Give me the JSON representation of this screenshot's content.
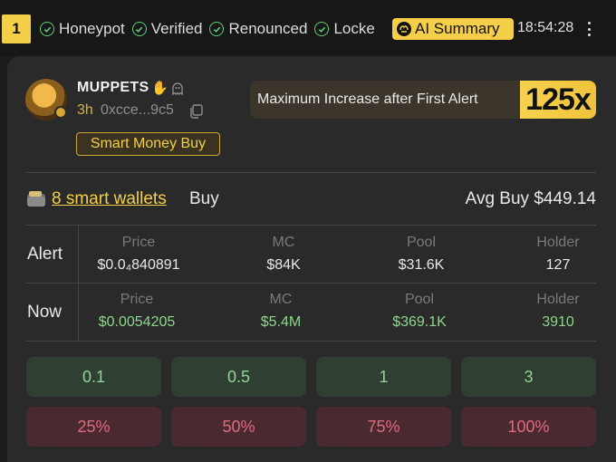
{
  "header": {
    "index": "1",
    "checks": [
      "Honeypot",
      "Verified",
      "Renounced",
      "Locke"
    ],
    "ai_summary_label": "AI Summary",
    "time": "18:54:28"
  },
  "token": {
    "name": "MUPPETS",
    "age": "3h",
    "address": "0xcce...9c5",
    "tag": "Smart Money Buy"
  },
  "max_increase": {
    "label": "Maximum Increase after First Alert",
    "value": "125x"
  },
  "smart": {
    "wallets_link": "8 smart wallets",
    "buy_word": "Buy",
    "avg_buy": "Avg Buy $449.14"
  },
  "table": {
    "headers": [
      "Price",
      "MC",
      "Pool",
      "Holder"
    ],
    "rows": [
      {
        "label": "Alert",
        "values": [
          "$0.0₄840891",
          "$84K",
          "$31.6K",
          "127"
        ]
      },
      {
        "label": "Now",
        "values": [
          "$0.0054205",
          "$5.4M",
          "$369.1K",
          "3910"
        ]
      }
    ]
  },
  "buy_buttons": [
    "0.1",
    "0.5",
    "1",
    "3"
  ],
  "sell_buttons": [
    "25%",
    "50%",
    "75%",
    "100%"
  ],
  "colors": {
    "accent": "#f4cf47",
    "positive": "#8ed68e",
    "negative": "#e06a7c",
    "check": "#5fd07c"
  },
  "icons": [
    "check-circle-icon",
    "ai-brain-icon",
    "kebab-menu-icon",
    "wave-hand-icon",
    "ghost-icon",
    "copy-icon",
    "wallet-icon"
  ]
}
